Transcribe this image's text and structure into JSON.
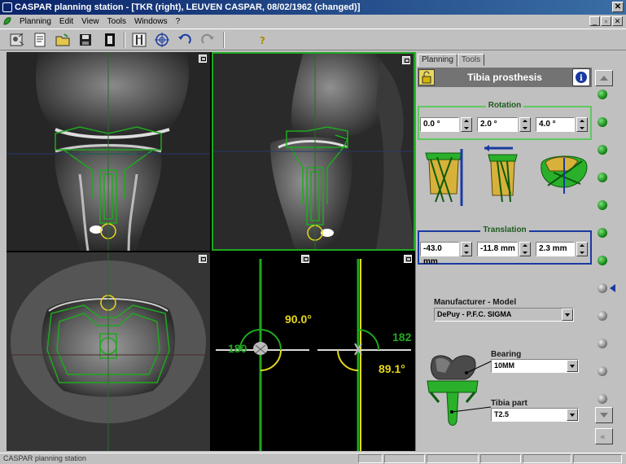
{
  "window": {
    "title": "CASPAR planning station - [TKR (right), LEUVEN CASPAR, 08/02/1962 (changed)]"
  },
  "menu": {
    "items": [
      "Planning",
      "Edit",
      "View",
      "Tools",
      "Windows",
      "?"
    ]
  },
  "toolbar": {
    "buttons": [
      "patients-icon",
      "report-icon",
      "open-folder-icon",
      "save-icon",
      "film-icon",
      "bone-view-icon",
      "crosshair-icon",
      "undo-icon",
      "redo-icon",
      "help-icon"
    ]
  },
  "viewports": {
    "sagittal_angle": "90.0°",
    "coronal_left_value": "180",
    "coronal_right_value": "182",
    "coronal_angle": "89.1°"
  },
  "panel": {
    "tabs": [
      "Planning",
      "Tools"
    ],
    "active_tab": "Planning",
    "header": "Tibia prosthesis",
    "rotation": {
      "title": "Rotation",
      "values": [
        "0.0 °",
        "2.0 °",
        "4.0 °"
      ]
    },
    "translation": {
      "title": "Translation",
      "values": [
        "-43.0 mm",
        "-11.8 mm",
        "2.3 mm"
      ]
    },
    "manufacturer": {
      "label": "Manufacturer - Model",
      "value": "DePuy - P.F.C. SIGMA"
    },
    "bearing": {
      "label": "Bearing",
      "value": "10MM"
    },
    "tibia_part": {
      "label": "Tibia part",
      "value": "T2.5"
    }
  },
  "status": {
    "text": "CASPAR planning station"
  },
  "colors": {
    "implant_green": "#1fa81f",
    "guide_yellow": "#e6d81a",
    "accent_blue": "#1a3aa0"
  }
}
